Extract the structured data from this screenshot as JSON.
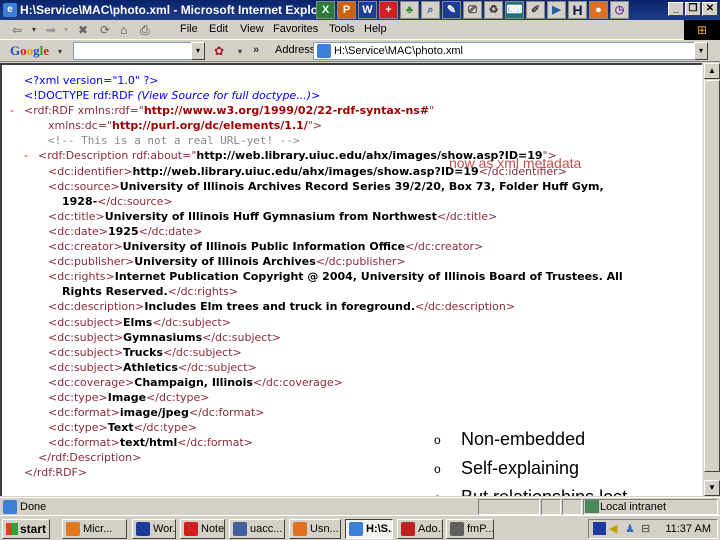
{
  "window": {
    "title": "H:\\Service\\MAC\\photo.xml - Microsoft Internet Explorer",
    "controls": {
      "minimize": "_",
      "restore": "❐",
      "close": "✕"
    }
  },
  "quick_launch": [
    "excel",
    "powerpoint",
    "word",
    "notes",
    "tree",
    "search",
    "pen",
    "scanner",
    "recycle",
    "keyboard",
    "paint",
    "media",
    "H",
    "firefox",
    "clock"
  ],
  "menu": [
    "File",
    "Edit",
    "View",
    "Favorites",
    "Tools",
    "Help"
  ],
  "toolbar": {
    "back": "⇦",
    "forward": "➡",
    "stop": "✖",
    "refresh": "⟳",
    "home": "⌂",
    "print": "⎙"
  },
  "google_bar": {
    "logo": "Google",
    "search_value": "",
    "more": "»"
  },
  "address": {
    "label": "Address",
    "value": "H:\\Service\\MAC\\photo.xml"
  },
  "xml_lines": {
    "l1": "<?xml version=\"1.0\" ?>",
    "l2_tag": "<!DOCTYPE rdf:RDF",
    "l2_note": "(View Source for full doctype...)",
    "l2_end": ">",
    "l3_minus": "-",
    "l3_tag": "<rdf:RDF xmlns:rdf=\"",
    "l3_val": "http://www.w3.org/1999/02/22-rdf-syntax-ns#",
    "l3_end": "\"",
    "l4_tag": "xmlns:dc=\"",
    "l4_val": "http://purl.org/dc/elements/1.1/",
    "l4_end": "\">",
    "l5": "<!-- This is a not a real URL-yet! -->",
    "l6_minus": "-",
    "l6_tag": "<rdf:Description rdf:about=\"",
    "l6_val": "http://web.library.uiuc.edu/ahx/images/show.asp?ID=19",
    "l6_end": "\">",
    "elements": [
      {
        "open": "<dc:identifier>",
        "value": "http://web.library.uiuc.edu/ahx/images/show.asp?ID=19",
        "close": "</dc:identifier>"
      },
      {
        "open": "<dc:source>",
        "value": "University of Illinois Archives Record Series 39/2/20, Box 73, Folder Huff Gym,",
        "cont": "1928-",
        "close": "</dc:source>"
      },
      {
        "open": "<dc:title>",
        "value": "University of Illinois Huff Gymnasium from Northwest",
        "close": "</dc:title>"
      },
      {
        "open": "<dc:date>",
        "value": "1925",
        "close": "</dc:date>"
      },
      {
        "open": "<dc:creator>",
        "value": "University of Illinois Public Information Office",
        "close": "</dc:creator>"
      },
      {
        "open": "<dc:publisher>",
        "value": "University of Illinois Archives",
        "close": "</dc:publisher>"
      },
      {
        "open": "<dc:rights>",
        "value": "Internet Publication Copyright @ 2004, University of Illinois Board of Trustees. All",
        "cont": "Rights Reserved.",
        "close": "</dc:rights>"
      },
      {
        "open": "<dc:description>",
        "value": "Includes Elm trees and truck in foreground.",
        "close": "</dc:description>"
      },
      {
        "open": "<dc:subject>",
        "value": "Elms",
        "close": "</dc:subject>"
      },
      {
        "open": "<dc:subject>",
        "value": "Gymnasiums",
        "close": "</dc:subject>"
      },
      {
        "open": "<dc:subject>",
        "value": "Trucks",
        "close": "</dc:subject>"
      },
      {
        "open": "<dc:subject>",
        "value": "Athletics",
        "close": "</dc:subject>"
      },
      {
        "open": "<dc:coverage>",
        "value": "Champaign, Illinois",
        "close": "</dc:coverage>"
      },
      {
        "open": "<dc:type>",
        "value": "Image",
        "close": "</dc:type>"
      },
      {
        "open": "<dc:format>",
        "value": "image/jpeg",
        "close": "</dc:format>"
      },
      {
        "open": "<dc:type>",
        "value": "Text",
        "close": "</dc:type>"
      },
      {
        "open": "<dc:format>",
        "value": "text/html",
        "close": "</dc:format>"
      }
    ],
    "close_description": "</rdf:Description>",
    "close_rdf": "</rdf:RDF>"
  },
  "overlay": {
    "title": "now as xml metadata",
    "bullet_mark": "o",
    "bullets": [
      "Non-embedded",
      "Self-explaining",
      "But relationships lost"
    ],
    "title_color": "#c0504d"
  },
  "statusbar": {
    "text": "Done",
    "zone": "Local intranet"
  },
  "taskbar": {
    "start": "start",
    "tasks": [
      {
        "label": "Micr...",
        "icon": "powerpoint-icon",
        "color": "#e07820"
      },
      {
        "label": "Wor...",
        "icon": "pen-icon",
        "color": "#1c3c9c"
      },
      {
        "label": "Note...",
        "icon": "notes-icon",
        "color": "#d02020"
      },
      {
        "label": "uacc...",
        "icon": "document-icon",
        "color": "#4060a0"
      },
      {
        "label": "Usn...",
        "icon": "firefox-icon",
        "color": "#e07020"
      },
      {
        "label": "H:\\S...",
        "icon": "ie-icon",
        "color": "#3b7fd6",
        "active": true
      },
      {
        "label": "Ado...",
        "icon": "acrobat-icon",
        "color": "#c02020"
      },
      {
        "label": "fmP...",
        "icon": "filemaker-icon",
        "color": "#606060"
      }
    ],
    "clock": "11:37 AM"
  }
}
